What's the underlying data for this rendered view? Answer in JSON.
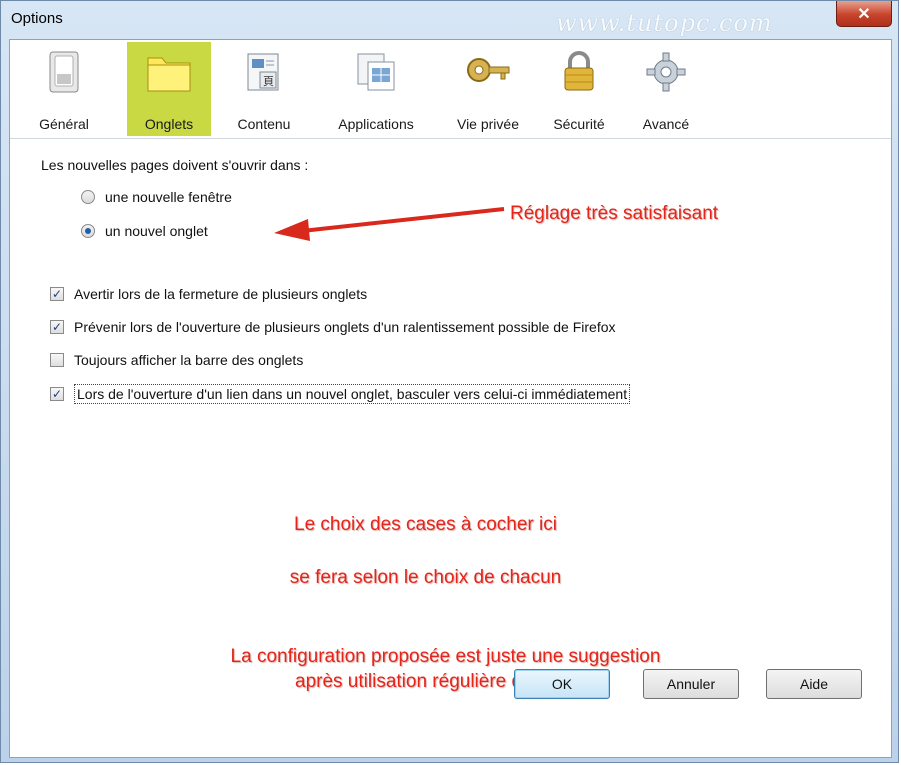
{
  "window": {
    "title": "Options",
    "watermark": "www.tutopc.com",
    "close_symbol": "✕"
  },
  "toolbar": {
    "items": [
      {
        "label": "Général",
        "icon": "switch-icon",
        "selected": false
      },
      {
        "label": "Onglets",
        "icon": "folder-tab-icon",
        "selected": true
      },
      {
        "label": "Contenu",
        "icon": "content-icon",
        "selected": false
      },
      {
        "label": "Applications",
        "icon": "applications-icon",
        "selected": false
      },
      {
        "label": "Vie privée",
        "icon": "key-icon",
        "selected": false
      },
      {
        "label": "Sécurité",
        "icon": "padlock-icon",
        "selected": false
      },
      {
        "label": "Avancé",
        "icon": "gear-icon",
        "selected": false
      }
    ]
  },
  "tabs_panel": {
    "open_pages_label": "Les nouvelles pages doivent s'ouvrir dans :",
    "radio_new_window": {
      "label": "une nouvelle fenêtre",
      "checked": false
    },
    "radio_new_tab": {
      "label": "un nouvel onglet",
      "checked": true
    },
    "checkboxes": [
      {
        "label": "Avertir lors de la fermeture de plusieurs onglets",
        "checked": true
      },
      {
        "label": "Prévenir lors de l'ouverture de plusieurs onglets d'un ralentissement possible de Firefox",
        "checked": true
      },
      {
        "label": "Toujours afficher la barre des onglets",
        "checked": false
      },
      {
        "label": "Lors de l'ouverture d'un lien dans un nouvel onglet, basculer vers celui-ci immédiatement",
        "checked": true
      }
    ]
  },
  "annotations": {
    "arrow_note": "Réglage très satisfaisant",
    "note_line1": "Le choix des cases à cocher ici",
    "note_line2": "se fera selon le choix de chacun",
    "note_line3": "La configuration proposée est juste une suggestion",
    "note_line4": "après utilisation régulière de Firefox",
    "color": "#e5241a"
  },
  "buttons": {
    "ok": "OK",
    "cancel": "Annuler",
    "help": "Aide"
  }
}
